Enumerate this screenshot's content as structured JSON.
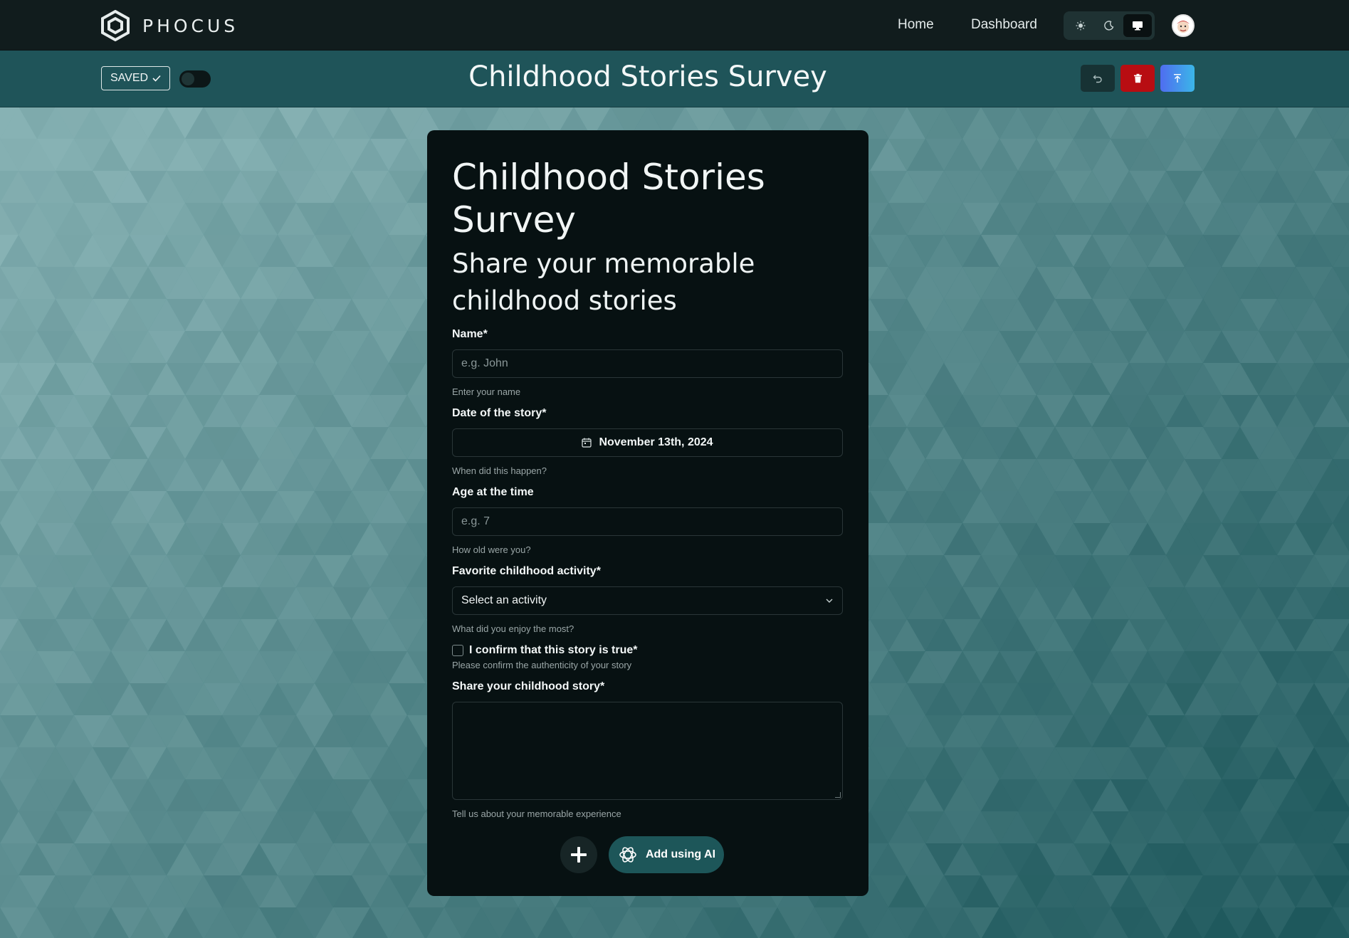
{
  "app": {
    "brand": "PHOCUS"
  },
  "nav": {
    "home": "Home",
    "dashboard": "Dashboard"
  },
  "theme": {
    "options": [
      "light-icon",
      "dark-icon",
      "system-icon"
    ],
    "active": "system"
  },
  "subbar": {
    "saved_label": "SAVED",
    "page_title": "Childhood Stories Survey"
  },
  "form": {
    "title": "Childhood Stories Survey",
    "subtitle": "Share your memorable childhood stories",
    "name": {
      "label": "Name*",
      "placeholder": "e.g. John",
      "help": "Enter your name"
    },
    "date": {
      "label": "Date of the story*",
      "value": "November 13th, 2024",
      "help": "When did this happen?"
    },
    "age": {
      "label": "Age at the time",
      "placeholder": "e.g. 7",
      "help": "How old were you?"
    },
    "activity": {
      "label": "Favorite childhood activity*",
      "value": "Select an activity",
      "help": "What did you enjoy the most?"
    },
    "confirm": {
      "label": "I confirm that this story is true*",
      "help": "Please confirm the authenticity of your story"
    },
    "story": {
      "label": "Share your childhood story*",
      "help": "Tell us about your memorable experience"
    },
    "ai_button": "Add using AI"
  },
  "colors": {
    "accent": "#1d5659",
    "delete": "#b80d12",
    "publish_from": "#4f6df0",
    "publish_to": "#3bb6e8"
  }
}
